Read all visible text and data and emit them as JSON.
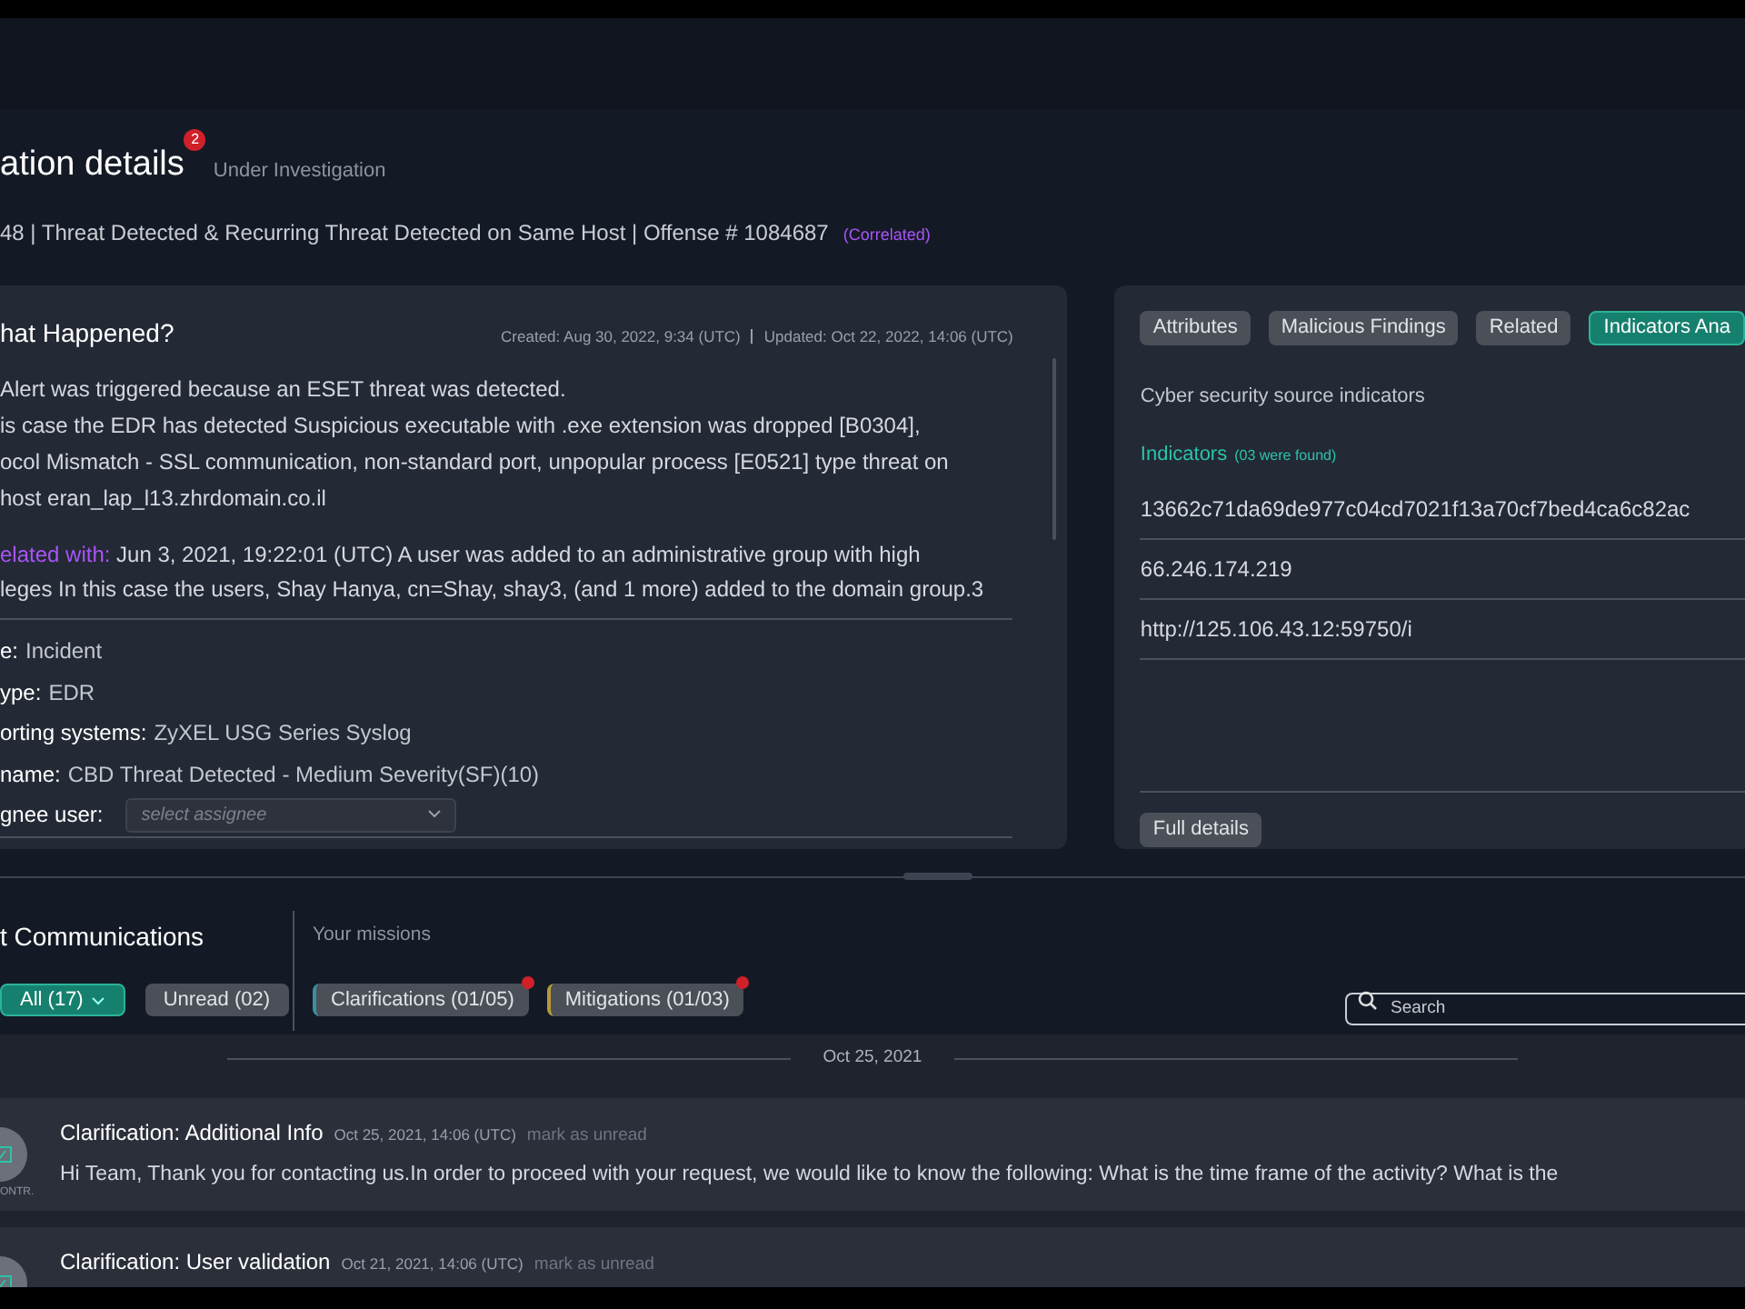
{
  "header": {
    "title": "ation details",
    "notification_count": "2",
    "status": "Under Investigation"
  },
  "subtitle": {
    "text": "48 | Threat Detected & Recurring Threat Detected on Same Host | Offense # 1084687",
    "tag": "(Correlated)"
  },
  "what_happened": {
    "title": "hat Happened?",
    "created": "Created: Aug 30, 2022, 9:34 (UTC)",
    "updated": "Updated: Oct 22, 2022, 14:06 (UTC)",
    "description": [
      "Alert was triggered because an ESET threat was detected.",
      "is case the EDR has detected Suspicious executable with .exe extension was dropped [B0304],",
      "ocol Mismatch - SSL communication, non-standard port, unpopular process [E0521] type threat on",
      "host eran_lap_l13.zhrdomain.co.il"
    ],
    "related_label": "elated with:",
    "related_text": "Jun 3, 2021, 19:22:01 (UTC) A user was added to an administrative group with high",
    "related_text_2": "leges In this case the users, Shay Hanya, cn=Shay, shay3, (and 1 more) added to the domain group.3",
    "fields": [
      {
        "label": "e:",
        "value": "Incident"
      },
      {
        "label": "ype:",
        "value": "EDR"
      },
      {
        "label": "orting systems:",
        "value": "ZyXEL USG Series Syslog"
      },
      {
        "label": "name:",
        "value": "CBD Threat Detected -  Medium Severity(SF)(10)"
      }
    ],
    "assignee": {
      "label": "gnee user:",
      "placeholder": "select assignee"
    }
  },
  "details_panel": {
    "tabs": [
      {
        "label": "Attributes",
        "selected": false
      },
      {
        "label": "Malicious Findings",
        "selected": false
      },
      {
        "label": "Related",
        "selected": false
      },
      {
        "label": "Indicators Ana",
        "selected": true
      }
    ],
    "caption": "Cyber security source indicators",
    "indicators_label": "Indicators",
    "indicators_count": "(03 were found)",
    "indicators": [
      "13662c71da69de977c04cd7021f13a70cf7bed4ca6c82ac",
      "66.246.174.219",
      "http://125.106.43.12:59750/i"
    ],
    "button": "Full details"
  },
  "communications": {
    "title": "t Communications",
    "missions_label": "Your missions",
    "filters": [
      {
        "label": "All (17)",
        "selected": true
      },
      {
        "label": "Unread (02)",
        "selected": false
      }
    ],
    "missions": [
      {
        "label": "Clarifications (01/05)",
        "unread": true,
        "color": "#3b8fa0"
      },
      {
        "label": "Mitigations (01/03)",
        "unread": true,
        "color": "#b59a3a"
      }
    ],
    "search": {
      "placeholder": "Search"
    },
    "date": "Oct 25, 2021",
    "messages": [
      {
        "avatar": "ONTR.",
        "title": "Clarification: Additional Info",
        "time": "Oct 25, 2021, 14:06 (UTC)",
        "action": "mark as unread",
        "body": "Hi Team, Thank you for contacting us.In order to proceed with your request, we would like to know the following: What is the time frame of the activity? What is the"
      },
      {
        "title": "Clarification: User validation",
        "time": "Oct 21, 2021, 14:06 (UTC)",
        "action": "mark as unread"
      }
    ]
  }
}
